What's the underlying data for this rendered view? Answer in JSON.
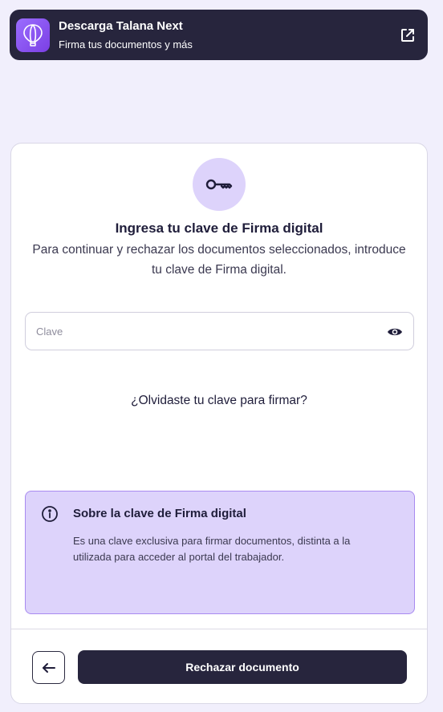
{
  "banner": {
    "logo": "hot-air-balloon-icon",
    "title": "Descarga Talana Next",
    "subtitle": "Firma tus documentos y más",
    "external_icon": "external-link-icon"
  },
  "card": {
    "icon": "key-icon",
    "title": "Ingresa tu clave de Firma digital",
    "description": "Para continuar y rechazar los documentos seleccionados, introduce tu clave de Firma digital.",
    "password_field": {
      "placeholder": "Clave",
      "value": "",
      "toggle_icon": "eye-icon"
    },
    "forgot_link": "¿Olvidaste tu clave para firmar?",
    "info": {
      "icon": "info-icon",
      "title": "Sobre la clave de Firma digital",
      "text": "Es una clave exclusiva para firmar documentos, distinta a la utilizada para acceder al portal del trabajador."
    },
    "footer": {
      "back_icon": "arrow-left-icon",
      "reject_label": "Rechazar documento"
    }
  },
  "colors": {
    "background": "#f1effc",
    "dark": "#27253d",
    "accent_light": "#ddd3fb",
    "accent_border": "#a88af0",
    "logo_purple": "#8b55f5"
  }
}
